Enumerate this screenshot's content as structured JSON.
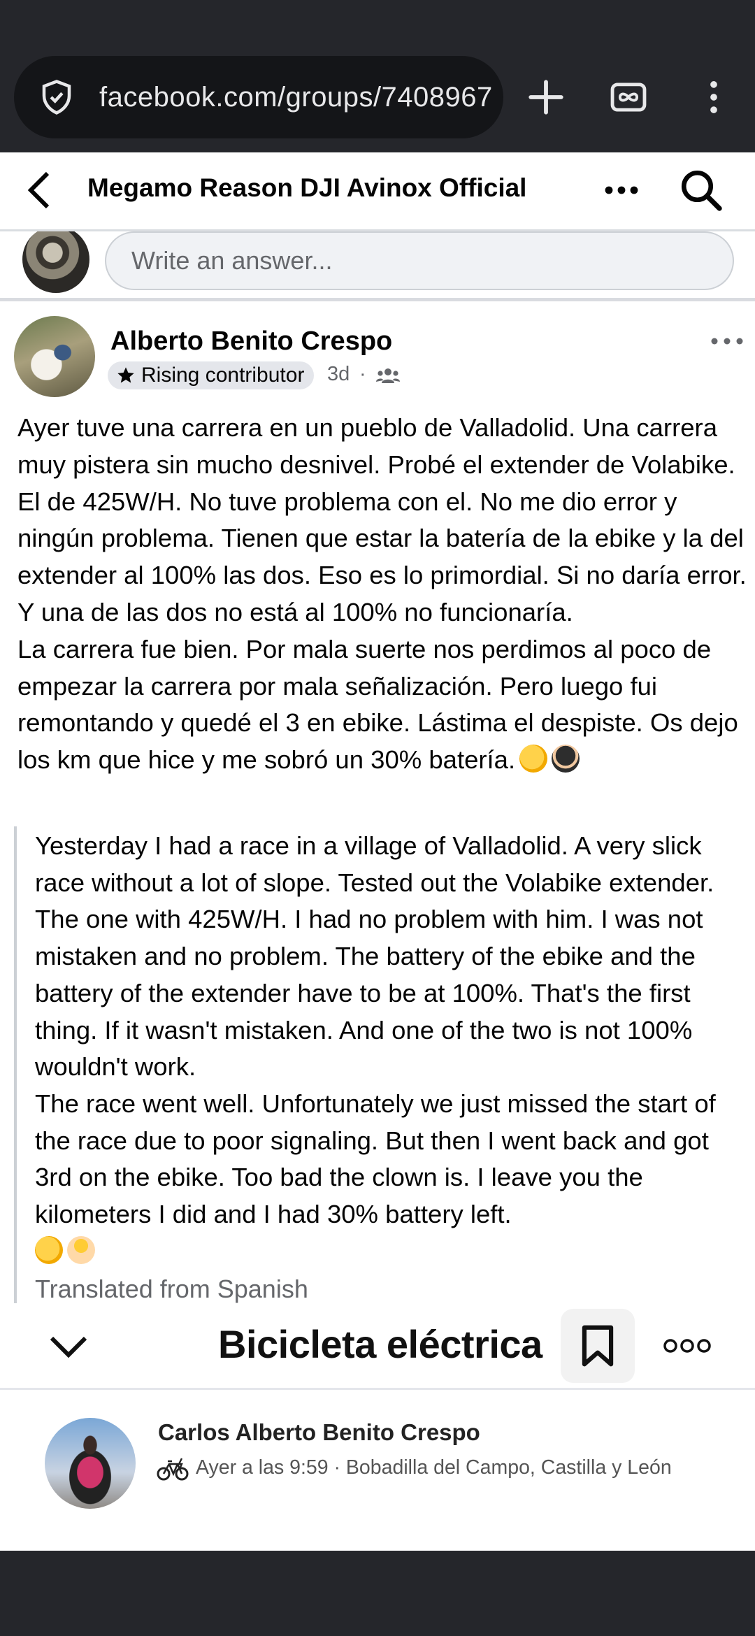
{
  "browser": {
    "url": "facebook.com/groups/7408967"
  },
  "header": {
    "title": "Megamo Reason DJI Avinox Official"
  },
  "answer": {
    "placeholder": "Write an answer..."
  },
  "post": {
    "author": "Alberto Benito Crespo",
    "badge": "Rising contributor",
    "time": "3d",
    "separator": "·",
    "original_text": "Ayer tuve una carrera en un pueblo de Valladolid. Una carrera muy pistera sin mucho desnivel. Probé el extender de Volabike. El de 425W/H. No tuve problema con el. No me dio error y ningún problema. Tienen que estar la batería de la ebike y la del extender al 100% las dos. Eso es lo primordial. Si no daría error. Y una de las dos no está al 100% no funcionaría.\nLa carrera fue bien. Por mala suerte nos perdimos al poco de empezar la carrera por mala señalización. Pero luego fui remontando y quedé el 3 en ebike. Lástima el despiste. Os dejo los km que hice y me sobró un 30% batería.",
    "translation": "Yesterday I had a race in a village of Valladolid. A very slick race without a lot of slope. Tested out the Volabike extender. The one with 425W/H. I had no problem with him. I was not mistaken and no problem. The battery of the ebike and the battery of the extender have to be at 100%. That's the first thing. If it wasn't mistaken. And one of the two is not 100% wouldn't work.\nThe race went well. Unfortunately we just missed the start of the race due to poor signaling. But then I went back and got 3rd on the ebike. Too bad the clown is. I leave you the kilometers I did and I had 30% battery left.",
    "translated_note": "Translated from Spanish"
  },
  "card": {
    "title": "Bicicleta eléctrica",
    "athlete": "Carlos Alberto Benito Crespo",
    "meta": "Ayer a las 9:59 · Bobadilla del Campo, Castilla y León"
  },
  "colors": {
    "browser_bg": "#25262b",
    "url_pill": "#141518",
    "text_secondary": "#65676b",
    "divider": "#dadde1"
  },
  "icons": [
    "shield-icon",
    "plus-icon",
    "tab-switcher-icon",
    "kebab-menu-icon",
    "back-arrow-icon",
    "more-horizontal-icon",
    "search-icon",
    "star-icon",
    "group-audience-icon",
    "chevron-down-icon",
    "bookmark-icon",
    "bike-icon"
  ]
}
